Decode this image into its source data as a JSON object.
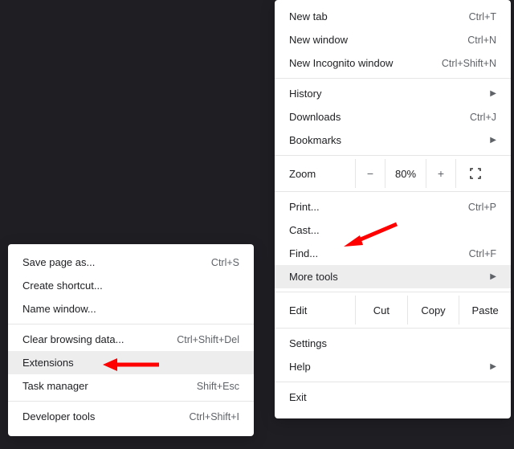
{
  "main_menu": {
    "new_tab": {
      "label": "New tab",
      "shortcut": "Ctrl+T"
    },
    "new_window": {
      "label": "New window",
      "shortcut": "Ctrl+N"
    },
    "incognito": {
      "label": "New Incognito window",
      "shortcut": "Ctrl+Shift+N"
    },
    "history": {
      "label": "History"
    },
    "downloads": {
      "label": "Downloads",
      "shortcut": "Ctrl+J"
    },
    "bookmarks": {
      "label": "Bookmarks"
    },
    "zoom": {
      "label": "Zoom",
      "minus": "−",
      "value": "80%",
      "plus": "+"
    },
    "print": {
      "label": "Print...",
      "shortcut": "Ctrl+P"
    },
    "cast": {
      "label": "Cast..."
    },
    "find": {
      "label": "Find...",
      "shortcut": "Ctrl+F"
    },
    "more_tools": {
      "label": "More tools"
    },
    "edit": {
      "label": "Edit",
      "cut": "Cut",
      "copy": "Copy",
      "paste": "Paste"
    },
    "settings": {
      "label": "Settings"
    },
    "help": {
      "label": "Help"
    },
    "exit": {
      "label": "Exit"
    }
  },
  "sub_menu": {
    "save_page": {
      "label": "Save page as...",
      "shortcut": "Ctrl+S"
    },
    "create_shortcut": {
      "label": "Create shortcut..."
    },
    "name_window": {
      "label": "Name window..."
    },
    "clear_data": {
      "label": "Clear browsing data...",
      "shortcut": "Ctrl+Shift+Del"
    },
    "extensions": {
      "label": "Extensions"
    },
    "task_manager": {
      "label": "Task manager",
      "shortcut": "Shift+Esc"
    },
    "dev_tools": {
      "label": "Developer tools",
      "shortcut": "Ctrl+Shift+I"
    }
  }
}
